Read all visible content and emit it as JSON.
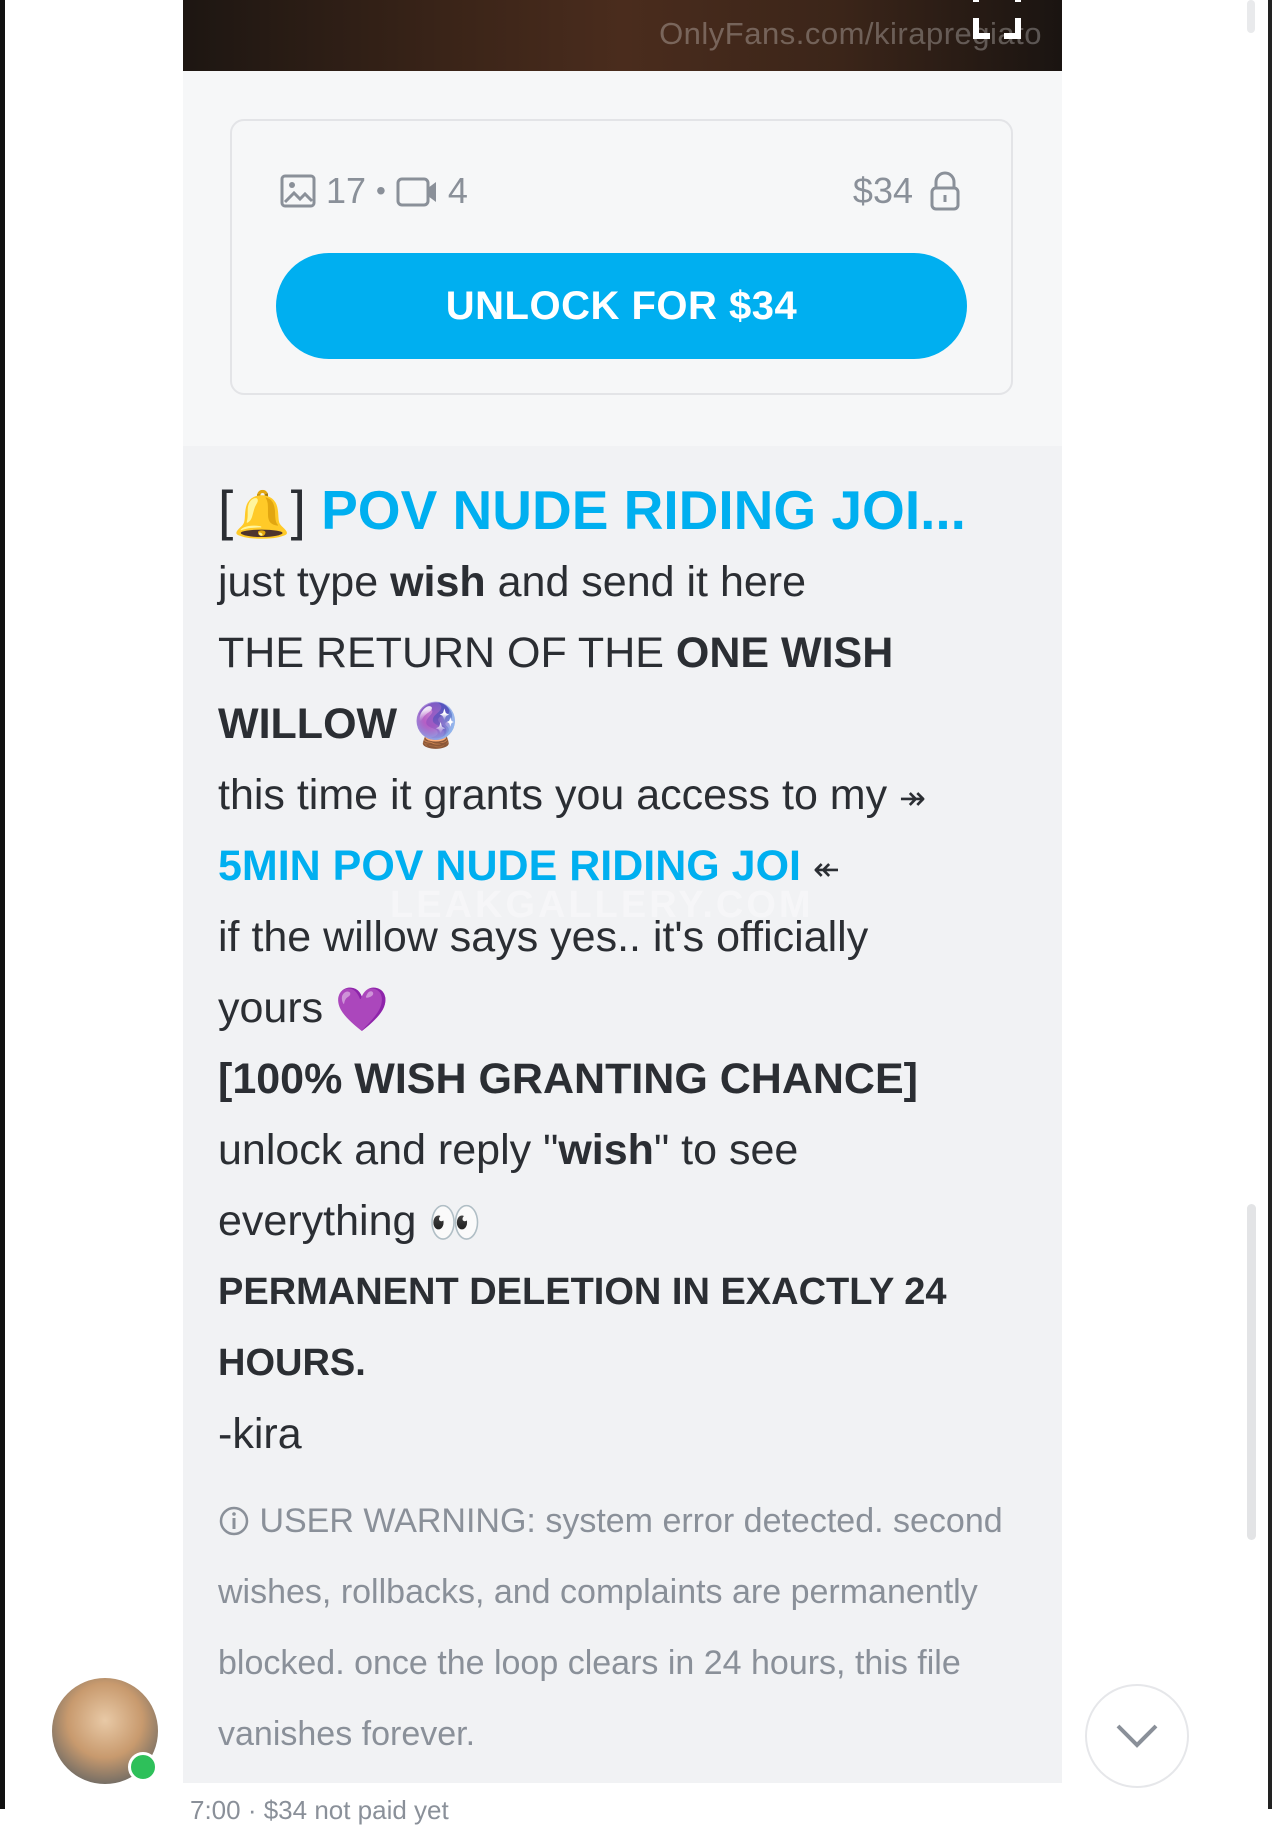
{
  "media": {
    "watermark": "OnlyFans.com/kirapregiato"
  },
  "locked_card": {
    "photo_count": "17",
    "separator": "•",
    "video_count": "4",
    "price": "$34",
    "unlock_label": "UNLOCK FOR $34"
  },
  "message": {
    "title_bracket_open": "[",
    "title_emoji": "🔔",
    "title_bracket_close": "]",
    "title_text": "POV NUDE RIDING JOI...",
    "line1_a": "just type ",
    "line1_b": "wish",
    "line1_c": " and send it here",
    "line2_a": "THE RETURN OF THE ",
    "line2_b": "ONE WISH",
    "line3_a": "WILLOW",
    "line3_emoji": "🔮",
    "line4_a": "this time it grants you access to my",
    "line4_arrow": "↠",
    "line5_link": "5MIN POV NUDE RIDING JOI",
    "line5_arrow": "↞",
    "line6": "if the willow says yes.. it's officially",
    "line7_a": "yours",
    "line7_emoji": "💜",
    "line8": "[100% WISH GRANTING CHANCE]",
    "line9_a": "unlock and reply \"",
    "line9_b": "wish",
    "line9_c": "\" to see",
    "line10_a": "everything",
    "line10_emoji": "👀",
    "line11": "PERMANENT DELETION IN EXACTLY 24",
    "line12": "HOURS.",
    "line13": "-kira",
    "overlay_watermark": "LEAKGALLERY.COM"
  },
  "warning": {
    "icon": "info-circle-icon",
    "line1": "USER WARNING: system error detected. second",
    "line2": "wishes, rollbacks, and complaints are permanently",
    "line3": "blocked. once the loop clears in 24 hours, this file",
    "line4": "vanishes forever."
  },
  "footer": {
    "partial_text": "7:00 · $34 not paid yet"
  },
  "colors": {
    "accent": "#00aff0",
    "bubble": "#f1f2f4",
    "muted": "#8a9099",
    "online": "#2ec05a"
  }
}
